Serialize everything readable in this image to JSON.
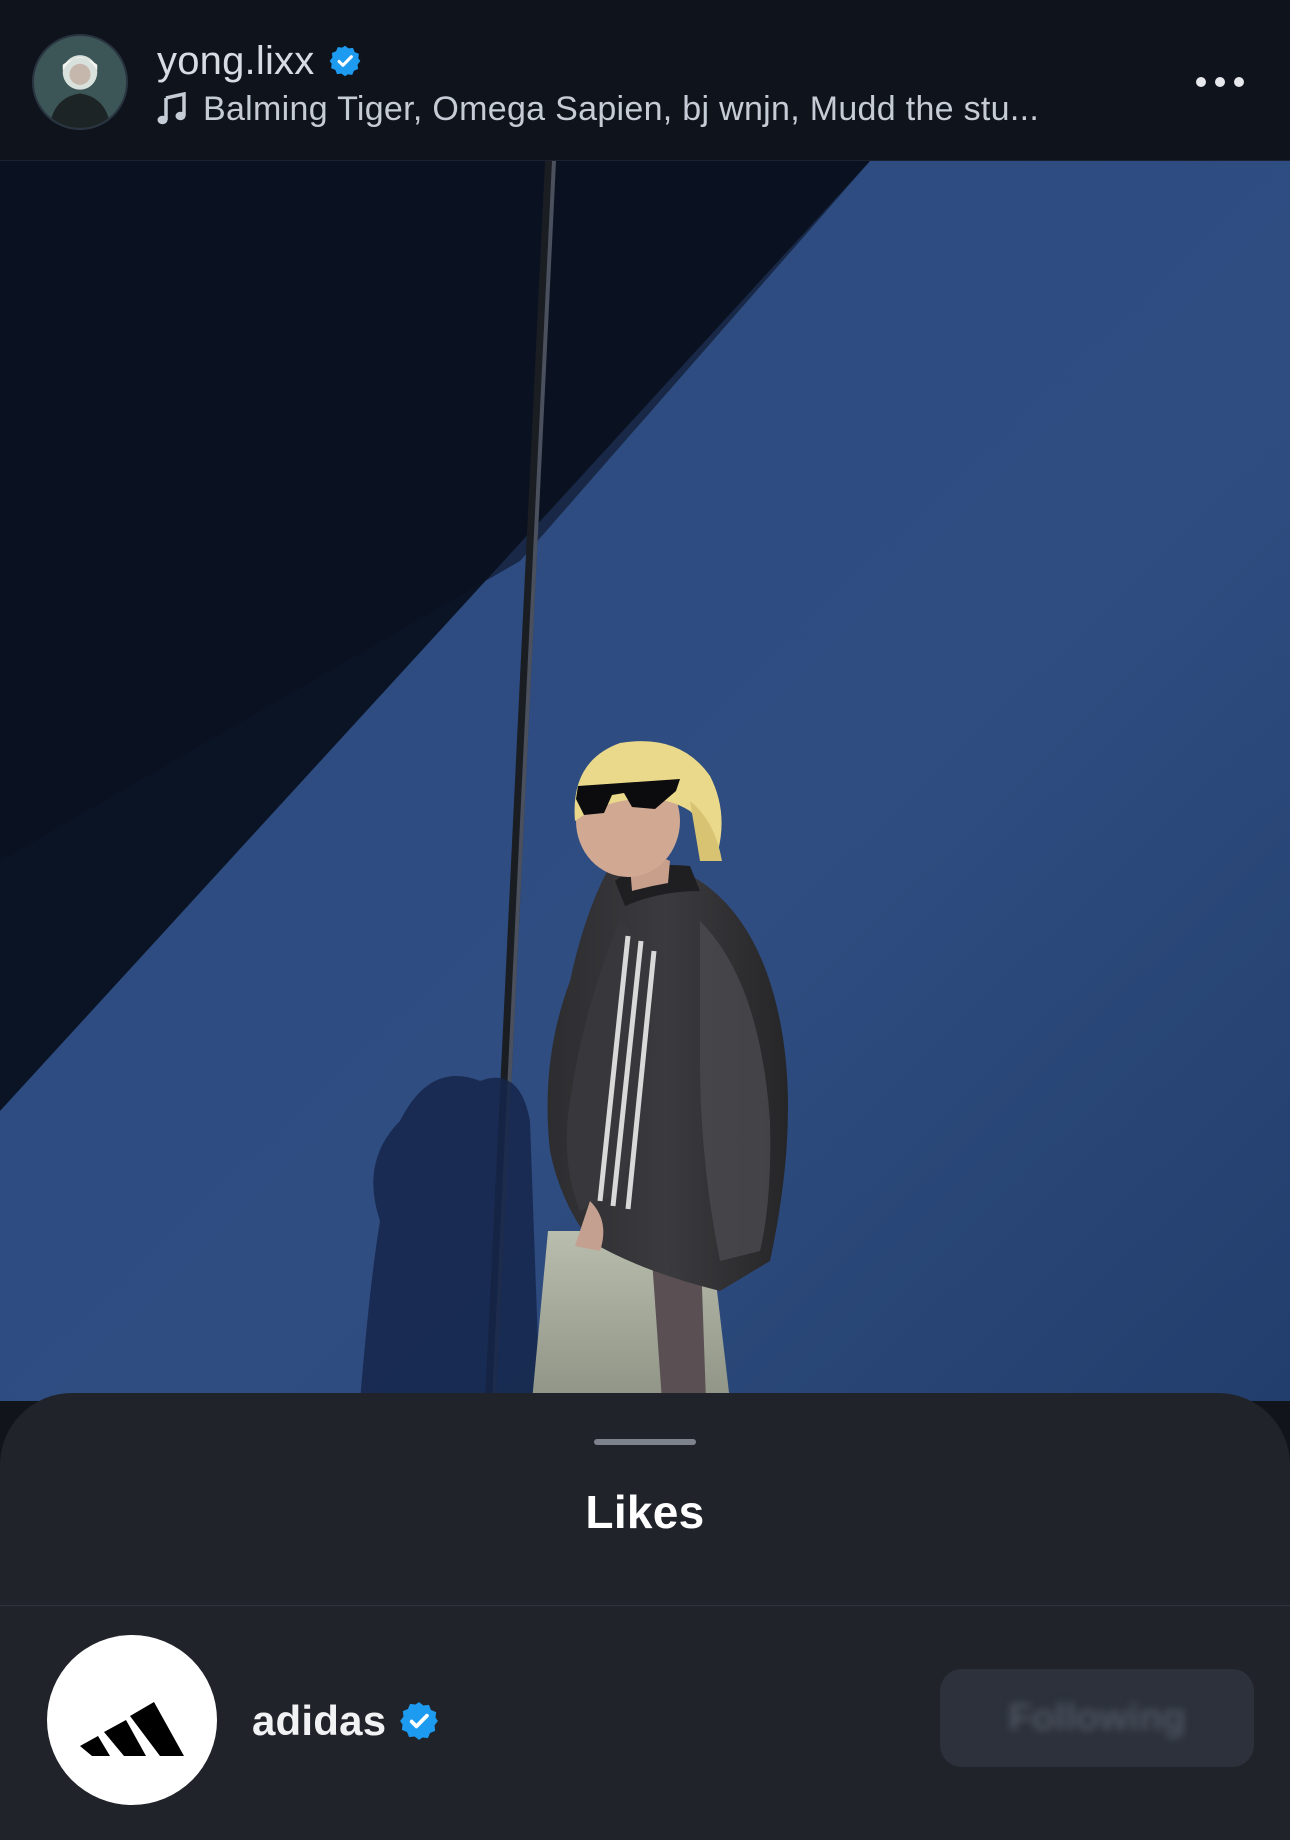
{
  "post": {
    "username": "yong.lixx",
    "verified_icon": "verified-badge-icon",
    "music": {
      "icon": "music-note-icon",
      "text": "Balming Tiger, Omega Sapien, bj wnjn, Mudd the stu..."
    },
    "more_icon": "more-options-icon"
  },
  "colors": {
    "verified_blue": "#1d9bf0",
    "sheet_background": "#21232b",
    "header_background": "#0f131c"
  },
  "likes_sheet": {
    "title": "Likes",
    "items": [
      {
        "username": "adidas",
        "verified": true,
        "avatar_icon": "adidas-logo-icon",
        "action_label": "Following"
      }
    ]
  }
}
